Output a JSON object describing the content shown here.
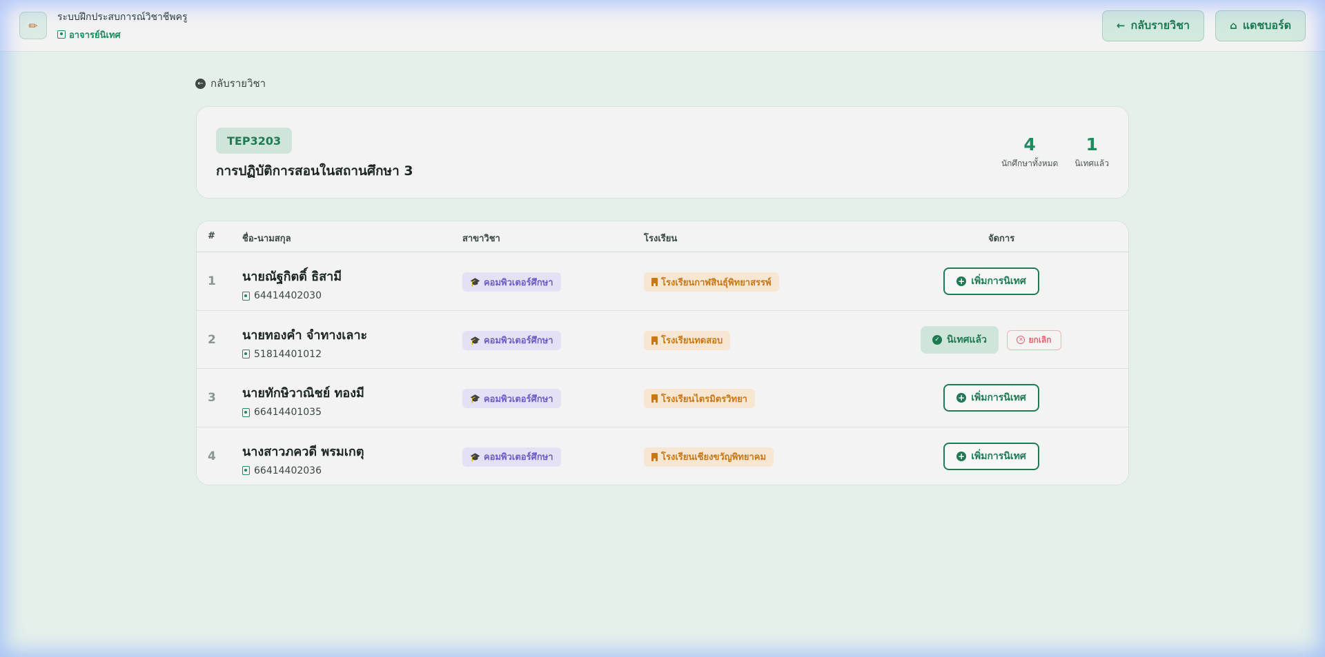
{
  "header": {
    "system_title": "ระบบฝึกประสบการณ์วิชาชีพครู",
    "role": "อาจารย์นิเทศ",
    "back_button": "กลับรายวิชา",
    "dashboard_button": "แดชบอร์ด"
  },
  "back_link": "กลับรายวิชา",
  "course": {
    "code": "TEP3203",
    "name": "การปฏิบัติการสอนในสถานศึกษา 3",
    "stats": [
      {
        "value": "4",
        "label": "นักศึกษาทั้งหมด"
      },
      {
        "value": "1",
        "label": "นิเทศแล้ว"
      }
    ]
  },
  "table": {
    "columns": [
      "#",
      "ชื่อ-นามสกุล",
      "สาขาวิชา",
      "โรงเรียน",
      "จัดการ"
    ],
    "rows": [
      {
        "num": "1",
        "name": "นายณัฐกิตติ์ ธิสามี",
        "id": "64414402030",
        "major": "คอมพิวเตอร์ศึกษา",
        "school": "โรงเรียนกาฬสินธุ์พิทยาสรรพ์",
        "status": "pending",
        "action": "เพิ่มการนิเทศ"
      },
      {
        "num": "2",
        "name": "นายทองคำ จำทางเลาะ",
        "id": "51814401012",
        "major": "คอมพิวเตอร์ศึกษา",
        "school": "โรงเรียนทดสอบ",
        "status": "done",
        "action": "นิเทศแล้ว",
        "cancel": "ยกเลิก"
      },
      {
        "num": "3",
        "name": "นายทักษิวาณิชย์ ทองมี",
        "id": "66414401035",
        "major": "คอมพิวเตอร์ศึกษา",
        "school": "โรงเรียนไตรมิตรวิทยา",
        "status": "pending",
        "action": "เพิ่มการนิเทศ"
      },
      {
        "num": "4",
        "name": "นางสาวภควดี พรมเกตุ",
        "id": "66414402036",
        "major": "คอมพิวเตอร์ศึกษา",
        "school": "โรงเรียนเชียงขวัญพิทยาคม",
        "status": "pending",
        "action": "เพิ่มการนิเทศ"
      }
    ]
  },
  "colors": {
    "primary": "#1f7a54",
    "accent_green": "#1f8a5d",
    "major_badge": "#6b5cc8",
    "school_badge": "#c87818",
    "cancel": "#e16470",
    "background": "#e5f0eb"
  }
}
